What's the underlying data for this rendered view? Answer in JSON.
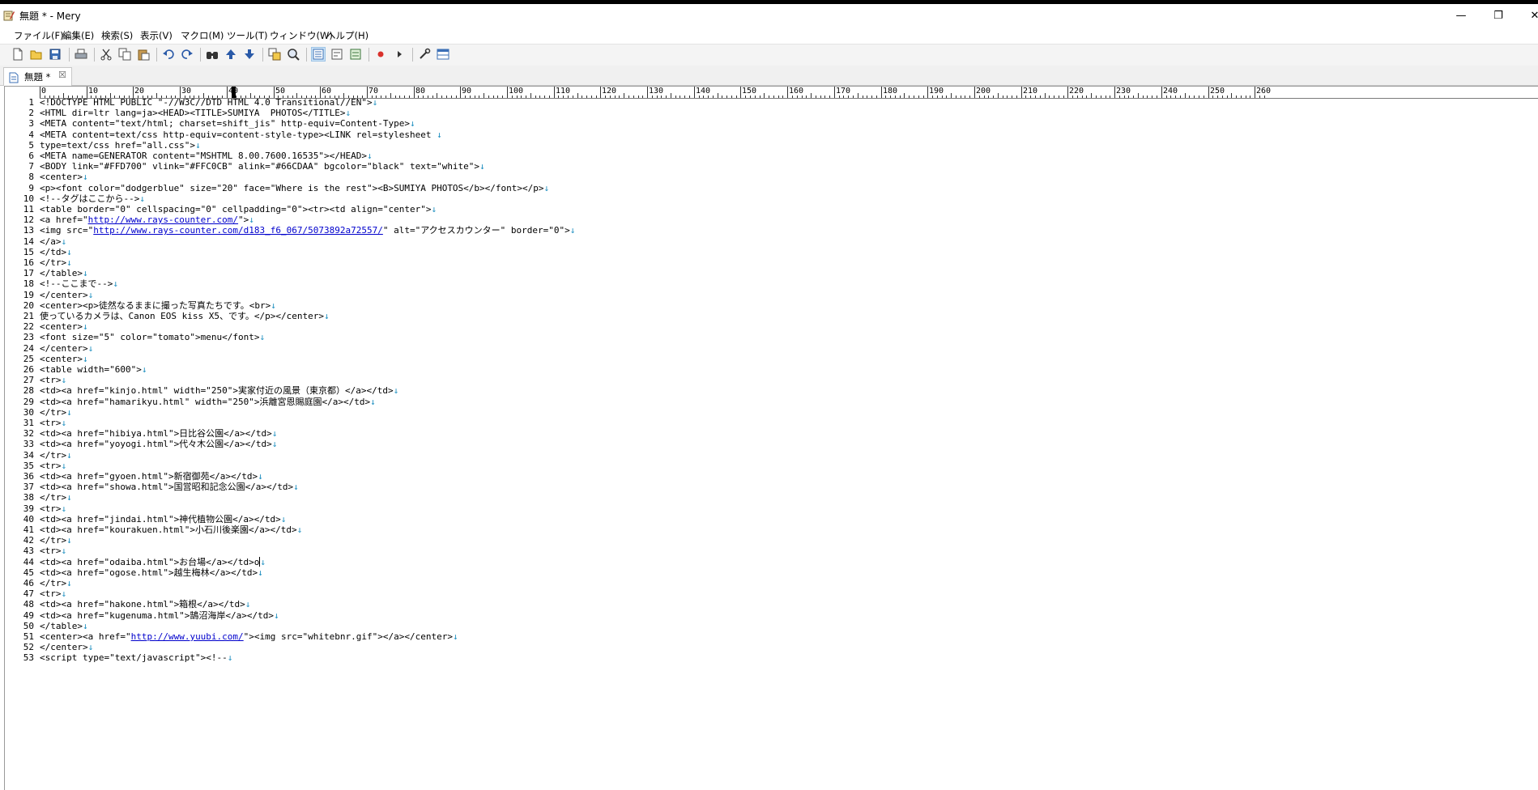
{
  "window": {
    "title": "無題 * - Mery",
    "minimize_glyph": "—",
    "restore_glyph": "❐",
    "close_glyph": "✕"
  },
  "menu": [
    "ファイル(F)",
    "編集(E)",
    "検索(S)",
    "表示(V)",
    "マクロ(M)",
    "ツール(T)",
    "ウィンドウ(W)",
    "ヘルプ(H)"
  ],
  "toolbar": {
    "buttons": [
      {
        "name": "new-file-icon"
      },
      {
        "name": "open-folder-icon"
      },
      {
        "name": "save-icon"
      },
      {
        "name": "print-icon"
      },
      {
        "name": "cut-icon"
      },
      {
        "name": "copy-icon"
      },
      {
        "name": "paste-icon"
      },
      {
        "name": "undo-icon"
      },
      {
        "name": "redo-icon"
      },
      {
        "name": "find-icon"
      },
      {
        "name": "find-prev-icon"
      },
      {
        "name": "find-next-icon"
      },
      {
        "name": "replace-icon"
      },
      {
        "name": "search-files-icon"
      },
      {
        "name": "wrap-none-icon",
        "selected": true
      },
      {
        "name": "wrap-char-icon"
      },
      {
        "name": "wrap-window-icon"
      },
      {
        "name": "record-macro-icon"
      },
      {
        "name": "run-macro-icon"
      },
      {
        "name": "options-icon"
      },
      {
        "name": "window-layout-icon"
      }
    ]
  },
  "tab": {
    "label": "無題 *",
    "close": "☒"
  },
  "ruler": {
    "labels": [
      "0",
      "10",
      "20",
      "30",
      "40",
      "50",
      "60",
      "70",
      "80",
      "90",
      "100",
      "110",
      "120",
      "130",
      "140",
      "150",
      "160",
      "170",
      "180",
      "190",
      "200",
      "210",
      "220",
      "230",
      "240",
      "250",
      "260"
    ]
  },
  "editor": {
    "eol_glyph": "↓",
    "cursor": {
      "line": 44,
      "column": 41
    },
    "lines": [
      {
        "n": "1",
        "text": "<!DOCTYPE HTML PUBLIC \"-//W3C//DTD HTML 4.0 Transitional//EN\">"
      },
      {
        "n": "2",
        "text": "<HTML dir=ltr lang=ja><HEAD><TITLE>SUMIYA  PHOTOS</TITLE>"
      },
      {
        "n": "3",
        "text": "<META content=\"text/html; charset=shift_jis\" http-equiv=Content-Type>"
      },
      {
        "n": "4",
        "text": "<META content=text/css http-equiv=content-style-type><LINK rel=stylesheet "
      },
      {
        "n": "5",
        "text": "type=text/css href=\"all.css\">"
      },
      {
        "n": "6",
        "text": "<META name=GENERATOR content=\"MSHTML 8.00.7600.16535\"></HEAD>"
      },
      {
        "n": "7",
        "text": "<BODY link=\"#FFD700\" vlink=\"#FFC0CB\" alink=\"#66CDAA\" bgcolor=\"black\" text=\"white\">"
      },
      {
        "n": "8",
        "text": "<center>"
      },
      {
        "n": "9",
        "text": "<p><font color=\"dodgerblue\" size=\"20\" face=\"Where is the rest\"><B>SUMIYA PHOTOS</b></font></p>"
      },
      {
        "n": "10",
        "text": "<!--タグはここから-->"
      },
      {
        "n": "11",
        "text": "<table border=\"0\" cellspacing=\"0\" cellpadding=\"0\"><tr><td align=\"center\">"
      },
      {
        "n": "12",
        "pre": "<a href=\"",
        "link": "http://www.rays-counter.com/",
        "post": "\">"
      },
      {
        "n": "13",
        "pre": "<img src=\"",
        "link": "http://www.rays-counter.com/d183_f6_067/5073892a72557/",
        "post": "\" alt=\"アクセスカウンター\" border=\"0\">"
      },
      {
        "n": "14",
        "text": "</a>"
      },
      {
        "n": "15",
        "text": "</td>"
      },
      {
        "n": "16",
        "text": "</tr>"
      },
      {
        "n": "17",
        "text": "</table>"
      },
      {
        "n": "18",
        "text": "<!--ここまで-->"
      },
      {
        "n": "19",
        "text": "</center>"
      },
      {
        "n": "20",
        "text": "<center><p>徒然なるままに撮った写真たちです。<br>"
      },
      {
        "n": "21",
        "text": "使っているカメラは、Canon EOS kiss X5、です。</p></center>"
      },
      {
        "n": "22",
        "text": "<center>"
      },
      {
        "n": "23",
        "text": "<font size=\"5\" color=\"tomato\">menu</font>"
      },
      {
        "n": "24",
        "text": "</center>"
      },
      {
        "n": "25",
        "text": "<center>"
      },
      {
        "n": "26",
        "text": "<table width=\"600\">"
      },
      {
        "n": "27",
        "text": "<tr>"
      },
      {
        "n": "28",
        "text": "<td><a href=\"kinjo.html\" width=\"250\">実家付近の風景（東京都）</a></td>"
      },
      {
        "n": "29",
        "text": "<td><a href=\"hamarikyu.html\" width=\"250\">浜離宮恩賜庭園</a></td>"
      },
      {
        "n": "30",
        "text": "</tr>"
      },
      {
        "n": "31",
        "text": "<tr>"
      },
      {
        "n": "32",
        "text": "<td><a href=\"hibiya.html\">日比谷公園</a></td>"
      },
      {
        "n": "33",
        "text": "<td><a href=\"yoyogi.html\">代々木公園</a></td>"
      },
      {
        "n": "34",
        "text": "</tr>"
      },
      {
        "n": "35",
        "text": "<tr>"
      },
      {
        "n": "36",
        "text": "<td><a href=\"gyoen.html\">新宿御苑</a></td>"
      },
      {
        "n": "37",
        "text": "<td><a href=\"showa.html\">国営昭和記念公園</a></td>"
      },
      {
        "n": "38",
        "text": "</tr>"
      },
      {
        "n": "39",
        "text": "<tr>"
      },
      {
        "n": "40",
        "text": "<td><a href=\"jindai.html\">神代植物公園</a></td>"
      },
      {
        "n": "41",
        "text": "<td><a href=\"kourakuen.html\">小石川後楽園</a></td>"
      },
      {
        "n": "42",
        "text": "</tr>"
      },
      {
        "n": "43",
        "text": "<tr>"
      },
      {
        "n": "44",
        "text": "<td><a href=\"odaiba.html\">お台場</a></td>o",
        "cursor": true
      },
      {
        "n": "45",
        "text": "<td><a href=\"ogose.html\">越生梅林</a></td>"
      },
      {
        "n": "46",
        "text": "</tr>"
      },
      {
        "n": "47",
        "text": "<tr>"
      },
      {
        "n": "48",
        "text": "<td><a href=\"hakone.html\">箱根</a></td>"
      },
      {
        "n": "49",
        "text": "<td><a href=\"kugenuma.html\">鵠沼海岸</a></td>"
      },
      {
        "n": "50",
        "text": "</table>"
      },
      {
        "n": "51",
        "pre": "<center><a href=\"",
        "link": "http://www.yuubi.com/",
        "post": "\"><img src=\"whitebnr.gif\"></a></center>"
      },
      {
        "n": "52",
        "text": "</center>"
      },
      {
        "n": "53",
        "text": "<script type=\"text/javascript\"><!--"
      }
    ]
  },
  "colors": {
    "link": "#0000cc",
    "eol_mark": "#1e8fc0",
    "toolbar_bg": "#f4f4f4",
    "tabbar_bg": "#f0f0f0"
  }
}
